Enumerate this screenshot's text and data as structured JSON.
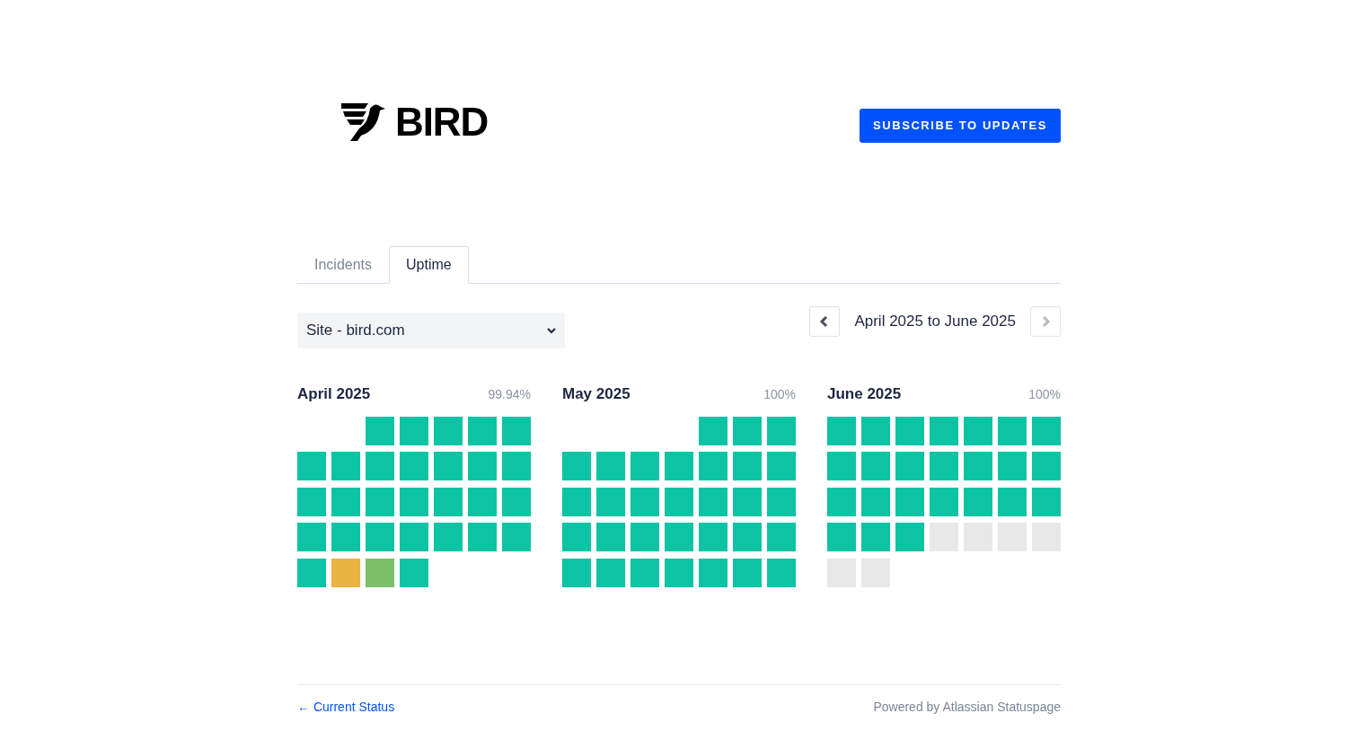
{
  "brand": {
    "name": "BIRD"
  },
  "subscribe_button": "SUBSCRIBE TO UPDATES",
  "tabs": [
    {
      "label": "Incidents",
      "selected": false
    },
    {
      "label": "Uptime",
      "selected": true
    }
  ],
  "component_select": {
    "value": "Site - bird.com"
  },
  "range": {
    "label": "April 2025 to June 2025",
    "prev_disabled": false,
    "next_disabled": true
  },
  "months": [
    {
      "title": "April 2025",
      "uptime": "99.94%",
      "days": [
        {
          "color": "#0cc4a4"
        },
        {
          "color": "#0cc4a4"
        },
        {
          "color": "#0cc4a4"
        },
        {
          "color": "#0cc4a4"
        },
        {
          "color": "#0cc4a4"
        },
        {
          "color": "#0cc4a4"
        },
        {
          "color": "#0cc4a4"
        },
        {
          "color": "#0cc4a4"
        },
        {
          "color": "#0cc4a4"
        },
        {
          "color": "#0cc4a4"
        },
        {
          "color": "#0cc4a4"
        },
        {
          "color": "#0cc4a4"
        },
        {
          "color": "#0cc4a4"
        },
        {
          "color": "#0cc4a4"
        },
        {
          "color": "#0cc4a4"
        },
        {
          "color": "#0cc4a4"
        },
        {
          "color": "#0cc4a4"
        },
        {
          "color": "#0cc4a4"
        },
        {
          "color": "#0cc4a4"
        },
        {
          "color": "#0cc4a4"
        },
        {
          "color": "#0cc4a4"
        },
        {
          "color": "#0cc4a4"
        },
        {
          "color": "#0cc4a4"
        },
        {
          "color": "#0cc4a4"
        },
        {
          "color": "#0cc4a4"
        },
        {
          "color": "#0cc4a4"
        },
        {
          "color": "#0cc4a4"
        },
        {
          "color": "#e9b441"
        },
        {
          "color": "#7bbf6b"
        },
        {
          "color": "#0cc4a4"
        }
      ]
    },
    {
      "title": "May 2025",
      "uptime": "100%",
      "days": [
        {
          "color": "#0cc4a4"
        },
        {
          "color": "#0cc4a4"
        },
        {
          "color": "#0cc4a4"
        },
        {
          "color": "#0cc4a4"
        },
        {
          "color": "#0cc4a4"
        },
        {
          "color": "#0cc4a4"
        },
        {
          "color": "#0cc4a4"
        },
        {
          "color": "#0cc4a4"
        },
        {
          "color": "#0cc4a4"
        },
        {
          "color": "#0cc4a4"
        },
        {
          "color": "#0cc4a4"
        },
        {
          "color": "#0cc4a4"
        },
        {
          "color": "#0cc4a4"
        },
        {
          "color": "#0cc4a4"
        },
        {
          "color": "#0cc4a4"
        },
        {
          "color": "#0cc4a4"
        },
        {
          "color": "#0cc4a4"
        },
        {
          "color": "#0cc4a4"
        },
        {
          "color": "#0cc4a4"
        },
        {
          "color": "#0cc4a4"
        },
        {
          "color": "#0cc4a4"
        },
        {
          "color": "#0cc4a4"
        },
        {
          "color": "#0cc4a4"
        },
        {
          "color": "#0cc4a4"
        },
        {
          "color": "#0cc4a4"
        },
        {
          "color": "#0cc4a4"
        },
        {
          "color": "#0cc4a4"
        },
        {
          "color": "#0cc4a4"
        },
        {
          "color": "#0cc4a4"
        },
        {
          "color": "#0cc4a4"
        },
        {
          "color": "#0cc4a4"
        }
      ]
    },
    {
      "title": "June 2025",
      "uptime": "100%",
      "days": [
        {
          "color": "#0cc4a4"
        },
        {
          "color": "#0cc4a4"
        },
        {
          "color": "#0cc4a4"
        },
        {
          "color": "#0cc4a4"
        },
        {
          "color": "#0cc4a4"
        },
        {
          "color": "#0cc4a4"
        },
        {
          "color": "#0cc4a4"
        },
        {
          "color": "#0cc4a4"
        },
        {
          "color": "#0cc4a4"
        },
        {
          "color": "#0cc4a4"
        },
        {
          "color": "#0cc4a4"
        },
        {
          "color": "#0cc4a4"
        },
        {
          "color": "#0cc4a4"
        },
        {
          "color": "#0cc4a4"
        },
        {
          "color": "#0cc4a4"
        },
        {
          "color": "#0cc4a4"
        },
        {
          "color": "#0cc4a4"
        },
        {
          "color": "#0cc4a4"
        },
        {
          "color": "#0cc4a4"
        },
        {
          "color": "#0cc4a4"
        },
        {
          "color": "#0cc4a4"
        },
        {
          "color": "#0cc4a4"
        },
        {
          "color": "#0cc4a4"
        },
        {
          "color": "#0cc4a4"
        },
        {
          "color": "#e8e8e8"
        },
        {
          "color": "#e8e8e8"
        },
        {
          "color": "#e8e8e8"
        },
        {
          "color": "#e8e8e8"
        },
        {
          "color": "#e8e8e8"
        },
        {
          "color": "#e8e8e8"
        }
      ]
    }
  ],
  "footer": {
    "back_link": "← Current Status",
    "powered_by": "Powered by Atlassian Statuspage"
  }
}
